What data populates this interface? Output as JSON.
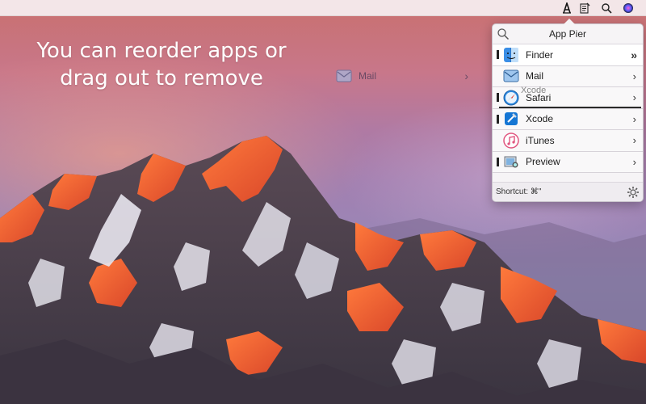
{
  "headline": {
    "line1": "You can reorder apps or",
    "line2": "drag out to remove"
  },
  "dragged_item": {
    "label": "Mail",
    "icon": "mail-icon",
    "chevron": "›"
  },
  "menubar": {
    "icons": [
      "app-pier-icon",
      "notes-icon",
      "search-icon",
      "siri-icon"
    ]
  },
  "popover": {
    "title": "App Pier",
    "search_icon": "search-icon",
    "apps": [
      {
        "label": "Finder",
        "icon": "finder-icon",
        "chevron": "»"
      },
      {
        "label": "Mail",
        "icon": "mail-icon",
        "chevron": "›"
      },
      {
        "label": "Safari",
        "icon": "safari-icon",
        "chevron": "›"
      },
      {
        "label": "Xcode",
        "icon": "xcode-icon",
        "chevron": "›"
      },
      {
        "label": "iTunes",
        "icon": "itunes-icon",
        "chevron": "›"
      },
      {
        "label": "Preview",
        "icon": "preview-icon",
        "chevron": "›"
      }
    ],
    "drop_preview_label": "Xcode",
    "footer": {
      "shortcut": "Shortcut: ⌘\"",
      "settings_icon": "gear-icon"
    }
  },
  "colors": {
    "accent": "#1e6fd9",
    "menubar_bg": "#f6f0f2",
    "popover_bg": "#f6f4f6"
  }
}
